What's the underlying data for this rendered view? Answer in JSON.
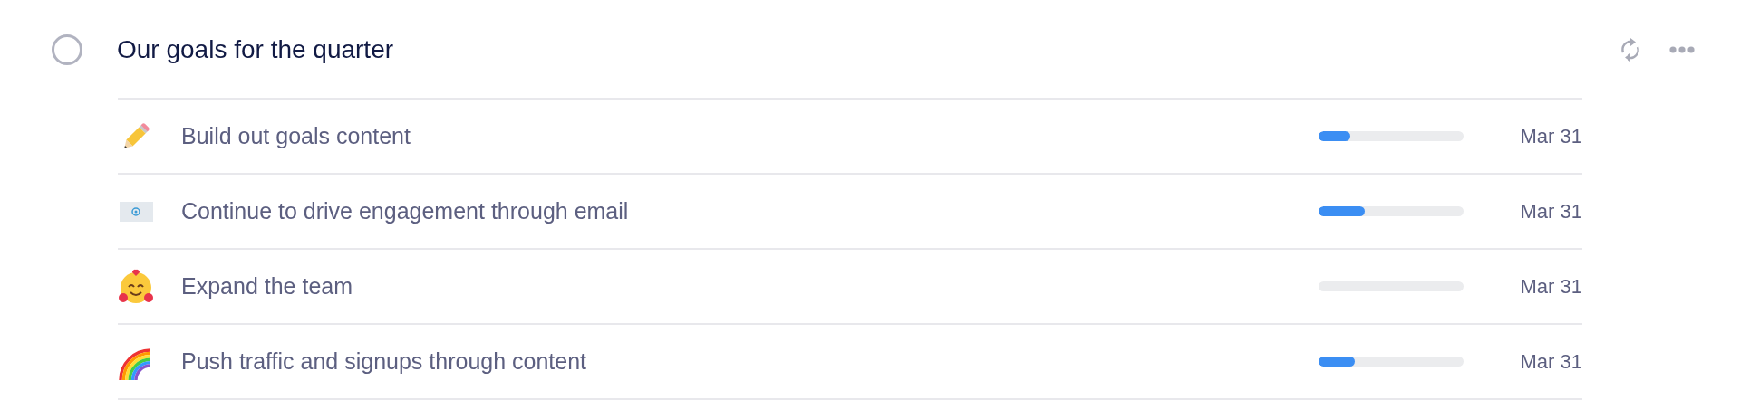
{
  "goal": {
    "title": "Our goals for the quarter",
    "checked": false
  },
  "rows": [
    {
      "label": "Build out goals content",
      "level": 0.22,
      "date": "Mar 31"
    },
    {
      "label": "Continue to drive engagement through email",
      "level": 0.32,
      "date": "Mar 31"
    },
    {
      "label": "Expand the team",
      "date": "Mar 31"
    },
    {
      "label": "Push traffic and signups through content",
      "level": 0.25,
      "date": "Mar 31"
    }
  ]
}
